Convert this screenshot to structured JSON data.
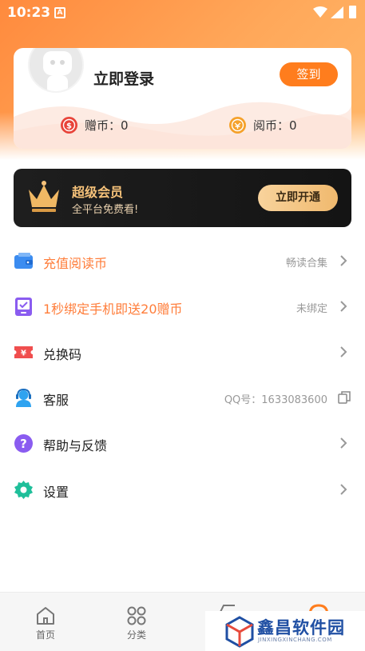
{
  "status_bar": {
    "time": "10:23",
    "notification_icon": "a-box-icon",
    "icons": [
      "wifi-icon",
      "signal-icon",
      "battery-icon"
    ]
  },
  "profile": {
    "login_text": "立即登录",
    "checkin_label": "签到",
    "gift_coin_label": "赠币：0",
    "read_coin_label": "阅币：0"
  },
  "vip": {
    "title": "超级会员",
    "subtitle": "全平台免费看!",
    "button": "立即开通"
  },
  "menu": [
    {
      "label": "充值阅读币",
      "value": "畅读合集",
      "icon": "wallet-icon",
      "highlight": true
    },
    {
      "label": "1秒绑定手机即送20赠币",
      "value": "未绑定",
      "icon": "phone-check-icon",
      "highlight": true
    },
    {
      "label": "兑换码",
      "value": "",
      "icon": "ticket-icon",
      "highlight": false
    },
    {
      "label": "客服",
      "value": "QQ号：1633083600",
      "icon": "headset-icon",
      "highlight": false
    },
    {
      "label": "帮助与反馈",
      "value": "",
      "icon": "question-icon",
      "highlight": false
    },
    {
      "label": "设置",
      "value": "",
      "icon": "gear-icon",
      "highlight": false
    }
  ],
  "bottom_nav": [
    {
      "label": "首页",
      "icon": "home-icon"
    },
    {
      "label": "分类",
      "icon": "category-icon"
    }
  ],
  "watermark": {
    "text": "鑫昌软件园",
    "sub": "JINXINGXINCHANG.COM"
  },
  "colors": {
    "accent": "#ff7d1d",
    "orange_text": "#ff7d3a",
    "vip_gold": "#f6c27a"
  }
}
